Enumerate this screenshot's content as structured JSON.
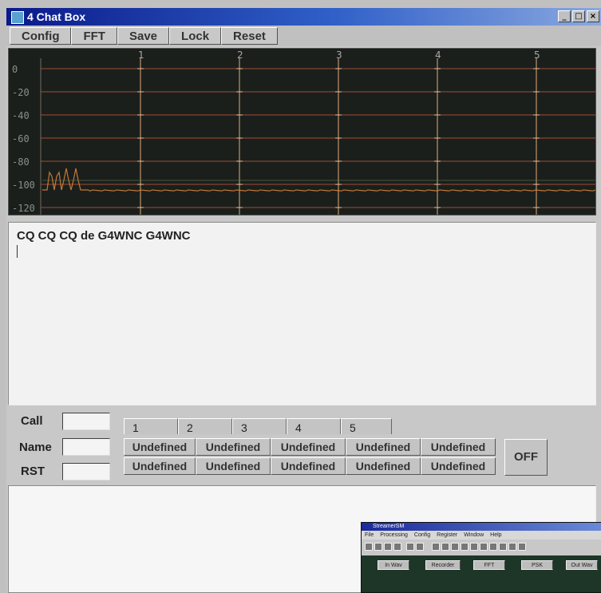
{
  "window": {
    "title": "4 Chat Box",
    "controls": {
      "minimize": "_",
      "maximize": "□",
      "close": "×"
    }
  },
  "toolbar": {
    "config": "Config",
    "fft": "FFT",
    "save": "Save",
    "lock": "Lock",
    "reset": "Reset"
  },
  "spectrum": {
    "channel_markers": [
      "1",
      "2",
      "3",
      "4",
      "5"
    ],
    "db_labels": [
      "0",
      "-20",
      "-40",
      "-60",
      "-80",
      "-100",
      "-120"
    ],
    "trace_color": "#e08a3a",
    "grid_color": "#d05a3a"
  },
  "receive": {
    "text": "CQ CQ CQ de G4WNC G4WNC"
  },
  "station": {
    "call_label": "Call",
    "name_label": "Name",
    "rst_label": "RST",
    "call_value": "",
    "name_value": "",
    "rst_value": ""
  },
  "tabs": [
    "1",
    "2",
    "3",
    "4",
    "5"
  ],
  "macros": {
    "row1": [
      "Undefined",
      "Undefined",
      "Undefined",
      "Undefined",
      "Undefined"
    ],
    "row2": [
      "Undefined",
      "Undefined",
      "Undefined",
      "Undefined",
      "Undefined"
    ]
  },
  "off_label": "OFF",
  "inset": {
    "title": "StreamerSM",
    "menu": [
      "File",
      "Processing",
      "Config",
      "Register",
      "Window",
      "Help"
    ],
    "buttons": [
      "In Wav",
      "Recorder",
      "FFT",
      "PSK",
      "Out Wav"
    ]
  },
  "colors": {
    "titlebar_start": "#0a1a8a",
    "spectrum_bg": "#1a1f1c",
    "panel": "#c0c0c0"
  }
}
